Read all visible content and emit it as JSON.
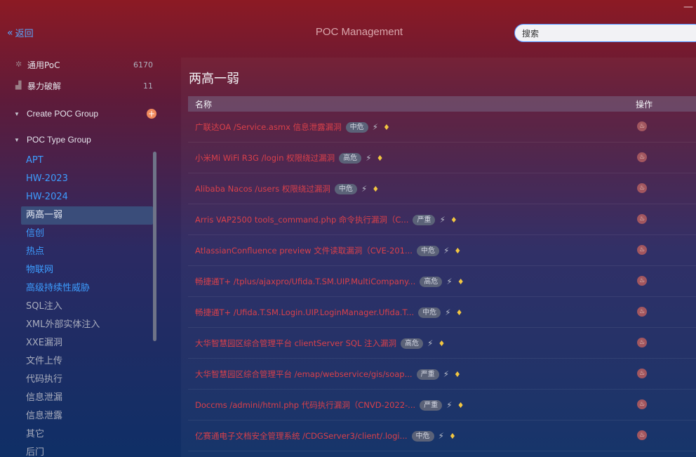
{
  "window": {
    "minimize_glyph": "—"
  },
  "header": {
    "back_label": "返回",
    "back_icon": "«",
    "title": "POC Management",
    "search_value": "搜索"
  },
  "sidebar": {
    "categories": [
      {
        "label": "通用PoC",
        "count": "6170",
        "icon": "gear-icon"
      },
      {
        "label": "暴力破解",
        "count": "11",
        "icon": "hammer-icon"
      }
    ],
    "create_group_label": "Create POC Group",
    "add_icon": "+",
    "type_group_label": "POC Type Group",
    "types": [
      {
        "label": "APT",
        "style": "link"
      },
      {
        "label": "HW-2023",
        "style": "link"
      },
      {
        "label": "HW-2024",
        "style": "link"
      },
      {
        "label": "两高一弱",
        "style": "active"
      },
      {
        "label": "信创",
        "style": "link"
      },
      {
        "label": "热点",
        "style": "link"
      },
      {
        "label": "物联网",
        "style": "link"
      },
      {
        "label": "高级持续性威胁",
        "style": "link"
      },
      {
        "label": "SQL注入",
        "style": "gray"
      },
      {
        "label": "XML外部实体注入",
        "style": "gray"
      },
      {
        "label": "XXE漏洞",
        "style": "gray"
      },
      {
        "label": "文件上传",
        "style": "gray"
      },
      {
        "label": "代码执行",
        "style": "gray"
      },
      {
        "label": "信息泄漏",
        "style": "gray"
      },
      {
        "label": "信息泄露",
        "style": "gray"
      },
      {
        "label": "其它",
        "style": "gray"
      },
      {
        "label": "后门",
        "style": "gray"
      }
    ]
  },
  "main": {
    "page_title": "两高一弱",
    "columns": {
      "name": "名称",
      "ops": "操作"
    },
    "rows": [
      {
        "name": "广联达OA /Service.asmx 信息泄露漏洞",
        "severity": "中危"
      },
      {
        "name": "小米Mi WiFi R3G /login 权限绕过漏洞",
        "severity": "高危"
      },
      {
        "name": "Alibaba Nacos /users 权限绕过漏洞",
        "severity": "中危"
      },
      {
        "name": "Arris VAP2500 tools_command.php 命令执行漏洞（C...",
        "severity": "严重"
      },
      {
        "name": "AtlassianConfluence preview 文件读取漏洞（CVE-201...",
        "severity": "中危"
      },
      {
        "name": "畅捷通T+ /tplus/ajaxpro/Ufida.T.SM.UIP.MultiCompany...",
        "severity": "高危"
      },
      {
        "name": "畅捷通T+ /Ufida.T.SM.Login.UIP.LoginManager.Ufida.T...",
        "severity": "中危"
      },
      {
        "name": "大华智慧园区综合管理平台 clientServer SQL 注入漏洞",
        "severity": "高危"
      },
      {
        "name": "大华智慧园区综合管理平台 /emap/webservice/gis/soap...",
        "severity": "严重"
      },
      {
        "name": "Doccms /admini/html.php 代码执行漏洞（CNVD-2022-...",
        "severity": "严重"
      },
      {
        "name": "亿赛通电子文档安全管理系统 /CDGServer3/client/.logi...",
        "severity": "中危"
      }
    ],
    "row_icons": {
      "bolt": "⚡",
      "gem": "♦",
      "op": "♨"
    }
  },
  "colors": {
    "link": "#3d9dff",
    "row_text": "#d9404a",
    "accent_add": "#f08a5d"
  }
}
